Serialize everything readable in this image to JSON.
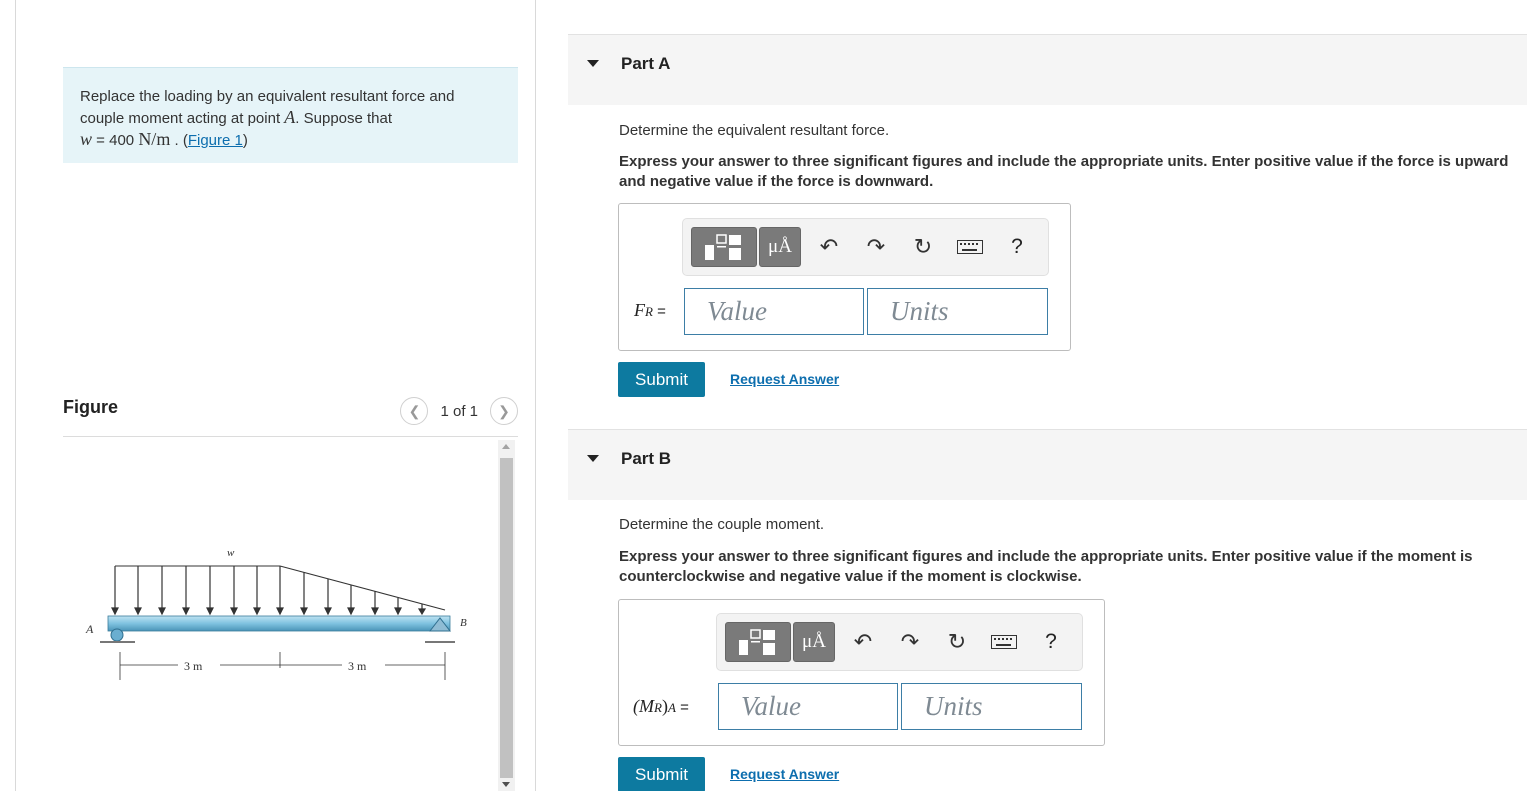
{
  "problem": {
    "text_1": "Replace the loading by an equivalent resultant force and couple moment acting at point",
    "point": "A",
    "text_2": ". Suppose that",
    "var": "w",
    "eq": " = 400 ",
    "unit": "N/m",
    "dot": " . ",
    "figure_link": "Figure 1"
  },
  "figure": {
    "title": "Figure",
    "pager": "1 of 1",
    "labels": {
      "w": "w",
      "a": "A",
      "b": "B",
      "dim1": "3 m",
      "dim2": "3 m"
    }
  },
  "part_a": {
    "title": "Part A",
    "prompt": "Determine the equivalent resultant force.",
    "instructions": "Express your answer to three significant figures and include the appropriate units. Enter positive value if the force is upward and negative value if the force is downward.",
    "label_main": "F",
    "label_sub": "R",
    "label_eq": " =",
    "value_placeholder": "Value",
    "units_placeholder": "Units",
    "submit": "Submit",
    "request": "Request Answer"
  },
  "part_b": {
    "title": "Part B",
    "prompt": "Determine the couple moment.",
    "instructions": "Express your answer to three significant figures and include the appropriate units. Enter positive value if the moment is counterclockwise and negative value if the moment is clockwise.",
    "label_open": "(M",
    "label_sub": "R",
    "label_close": ")",
    "label_sub2": "A",
    "label_eq": " =",
    "value_placeholder": "Value",
    "units_placeholder": "Units",
    "submit": "Submit",
    "request": "Request Answer"
  },
  "toolbar": {
    "symbols_label": "μÅ",
    "help_label": "?",
    "icons": [
      "templates-icon",
      "symbols-icon",
      "undo-icon",
      "redo-icon",
      "reset-icon",
      "keyboard-icon",
      "help-icon"
    ]
  },
  "colors": {
    "accent": "#0d7aa0",
    "link": "#0d6eae",
    "problem_bg": "#e6f4f8",
    "field_border": "#3d7ea6"
  }
}
